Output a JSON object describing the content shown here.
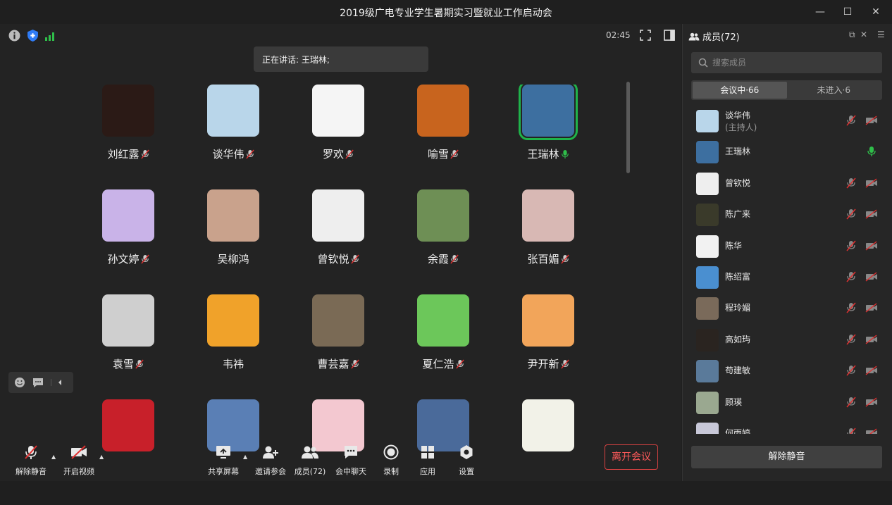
{
  "window": {
    "title": "2019级广电专业学生暑期实习暨就业工作启动会"
  },
  "status": {
    "timer": "02:45",
    "speaking_label": "正在讲话: 王瑞林;"
  },
  "grid": {
    "tiles": [
      {
        "name": "刘红露",
        "muted": true,
        "active": false,
        "color": "#2b1a16"
      },
      {
        "name": "谈华伟",
        "muted": true,
        "active": false,
        "color": "#b9d6ea"
      },
      {
        "name": "罗欢",
        "muted": true,
        "active": false,
        "color": "#f5f5f5"
      },
      {
        "name": "喻雪",
        "muted": true,
        "active": false,
        "color": "#c8641e"
      },
      {
        "name": "王瑞林",
        "muted": false,
        "active": true,
        "color": "#3d6fa0"
      },
      {
        "name": "孙文婷",
        "muted": true,
        "active": false,
        "color": "#c9b3e8"
      },
      {
        "name": "吴柳鸿",
        "muted": false,
        "active": false,
        "color": "#c9a28c"
      },
      {
        "name": "曾钦悦",
        "muted": true,
        "active": false,
        "color": "#eeeeee"
      },
      {
        "name": "余霞",
        "muted": true,
        "active": false,
        "color": "#6e8f55"
      },
      {
        "name": "张百媚",
        "muted": true,
        "active": false,
        "color": "#d8b8b4"
      },
      {
        "name": "袁雪",
        "muted": true,
        "active": false,
        "color": "#cfcfcf"
      },
      {
        "name": "韦祎",
        "muted": false,
        "active": false,
        "color": "#f0a22a"
      },
      {
        "name": "曹芸嘉",
        "muted": true,
        "active": false,
        "color": "#7a6a55"
      },
      {
        "name": "夏仁浩",
        "muted": true,
        "active": false,
        "color": "#6cc75a"
      },
      {
        "name": "尹开新",
        "muted": true,
        "active": false,
        "color": "#f2a55a"
      },
      {
        "name": "",
        "muted": false,
        "active": false,
        "color": "#c8202a"
      },
      {
        "name": "",
        "muted": false,
        "active": false,
        "color": "#5a7fb5"
      },
      {
        "name": "",
        "muted": false,
        "active": false,
        "color": "#f3c8d0"
      },
      {
        "name": "",
        "muted": false,
        "active": false,
        "color": "#4a6a9a"
      },
      {
        "name": "",
        "muted": false,
        "active": false,
        "color": "#f2f2e8"
      }
    ]
  },
  "toolbar": {
    "unmute": "解除静音",
    "start_video": "开启视频",
    "share_screen": "共享屏幕",
    "invite": "邀请参会",
    "members": "成员(72)",
    "chat": "会中聊天",
    "record": "录制",
    "apps": "应用",
    "settings": "设置",
    "leave": "离开会议"
  },
  "sidebar": {
    "title": "成员(72)",
    "search_placeholder": "搜索成员",
    "tab_in_meeting": "会议中·66",
    "tab_not_joined": "未进入·6",
    "unmute_all": "解除静音",
    "members": [
      {
        "name": "谈华伟",
        "sub": "(主持人)",
        "mic": "muted",
        "cam": true,
        "color": "#b9d6ea"
      },
      {
        "name": "王瑞林",
        "sub": "",
        "mic": "on",
        "cam": false,
        "color": "#3d6fa0"
      },
      {
        "name": "曾钦悦",
        "sub": "",
        "mic": "muted",
        "cam": true,
        "color": "#eeeeee"
      },
      {
        "name": "陈广来",
        "sub": "",
        "mic": "muted",
        "cam": true,
        "color": "#3a3a2a"
      },
      {
        "name": "陈华",
        "sub": "",
        "mic": "muted",
        "cam": true,
        "color": "#f2f2f2"
      },
      {
        "name": "陈绍富",
        "sub": "",
        "mic": "muted",
        "cam": true,
        "color": "#4a8fd0"
      },
      {
        "name": "程玲媚",
        "sub": "",
        "mic": "muted",
        "cam": true,
        "color": "#7a6a5a"
      },
      {
        "name": "高如玙",
        "sub": "",
        "mic": "muted",
        "cam": true,
        "color": "#2a2420"
      },
      {
        "name": "苟建敏",
        "sub": "",
        "mic": "muted",
        "cam": true,
        "color": "#5a7a9a"
      },
      {
        "name": "顾瑛",
        "sub": "",
        "mic": "muted",
        "cam": true,
        "color": "#9aa890"
      },
      {
        "name": "何雨婷",
        "sub": "",
        "mic": "muted",
        "cam": true,
        "color": "#c8c8d8"
      }
    ]
  }
}
